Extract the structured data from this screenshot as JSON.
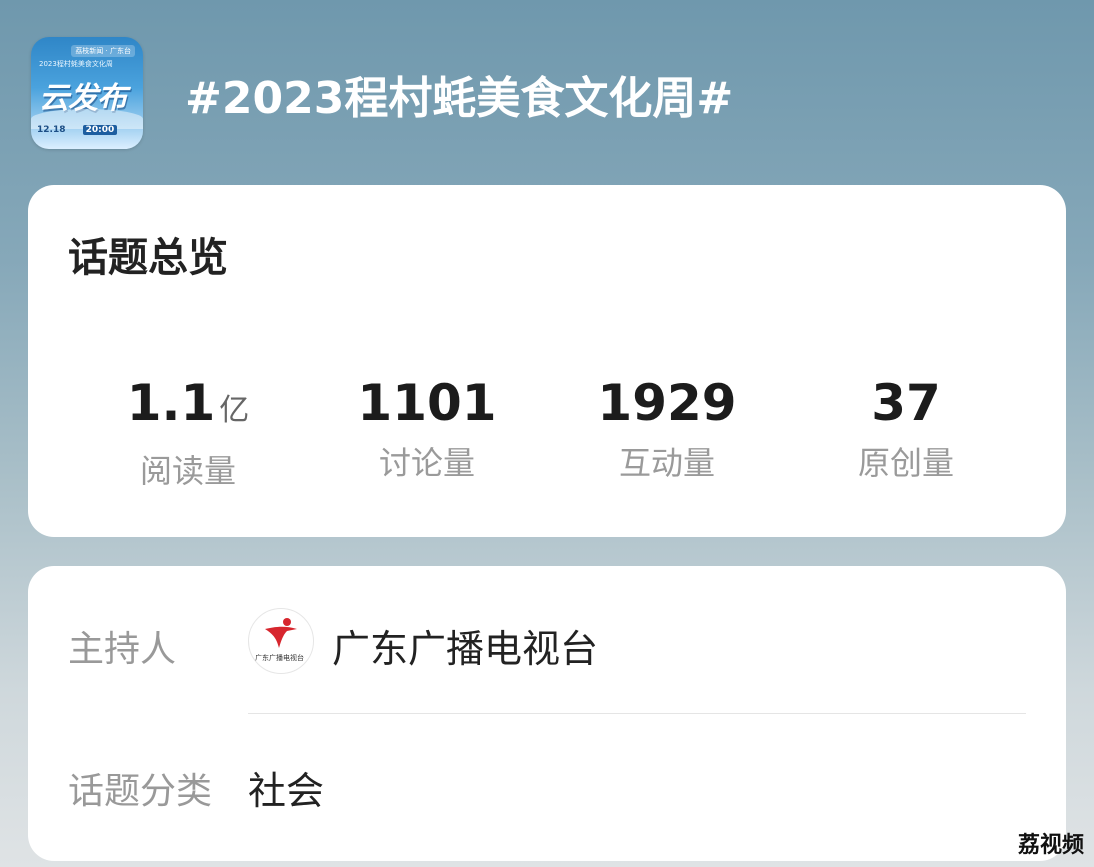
{
  "topic": {
    "title": "#2023程村蚝美食文化周#",
    "icon": {
      "name": "cloud-release-icon",
      "top_badge": "荔枝新闻 · 广东台",
      "subtitle": "2023程村蚝美食文化周",
      "main_text": "云发布",
      "date": "12.18",
      "time": "20:00"
    }
  },
  "overview": {
    "title": "话题总览",
    "stats": [
      {
        "value": "1.1",
        "unit": "亿",
        "label": "阅读量"
      },
      {
        "value": "1101",
        "unit": "",
        "label": "讨论量"
      },
      {
        "value": "1929",
        "unit": "",
        "label": "互动量"
      },
      {
        "value": "37",
        "unit": "",
        "label": "原创量"
      }
    ]
  },
  "info": {
    "host_label": "主持人",
    "host_name": "广东广播电视台",
    "host_logo_text": "广东广播电视台",
    "category_label": "话题分类",
    "category_value": "社会"
  },
  "watermark": "荔视频",
  "colors": {
    "bg_top": "#6f98ad",
    "bg_bottom": "#dfe3e5",
    "card": "#ffffff",
    "logo_red": "#d7262e"
  }
}
